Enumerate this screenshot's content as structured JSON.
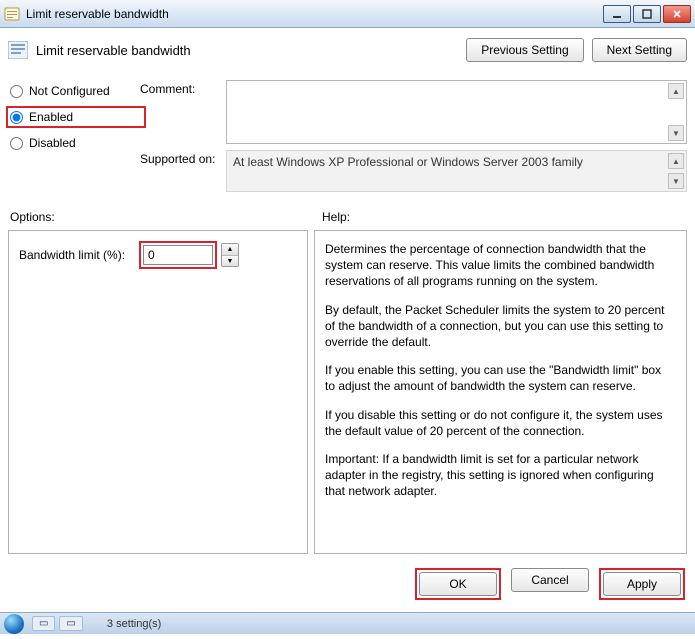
{
  "window": {
    "title": "Limit reservable bandwidth"
  },
  "header": {
    "title": "Limit reservable bandwidth",
    "prev_btn": "Previous Setting",
    "next_btn": "Next Setting"
  },
  "radios": {
    "not_configured": "Not Configured",
    "enabled": "Enabled",
    "disabled": "Disabled",
    "selected": "enabled"
  },
  "fields": {
    "comment_label": "Comment:",
    "comment_value": "",
    "supported_label": "Supported on:",
    "supported_value": "At least Windows XP Professional or Windows Server 2003 family"
  },
  "sections": {
    "options_label": "Options:",
    "help_label": "Help:"
  },
  "options": {
    "bandwidth_label": "Bandwidth limit (%):",
    "bandwidth_value": "0"
  },
  "help": {
    "p1": "Determines the percentage of connection bandwidth that the system can reserve. This value limits the combined bandwidth reservations of all programs running on the system.",
    "p2": "By default, the Packet Scheduler limits the system to 20 percent of the bandwidth of a connection, but you can use this setting to override the default.",
    "p3": "If you enable this setting, you can use the \"Bandwidth limit\" box to adjust the amount of bandwidth the system can reserve.",
    "p4": "If you disable this setting or do not configure it, the system uses the default value of 20 percent of the connection.",
    "p5": "Important: If a bandwidth limit is set for a particular network adapter in the registry, this setting is ignored when configuring that network adapter."
  },
  "footer": {
    "ok": "OK",
    "cancel": "Cancel",
    "apply": "Apply"
  },
  "taskbar": {
    "status": "3 setting(s)"
  }
}
